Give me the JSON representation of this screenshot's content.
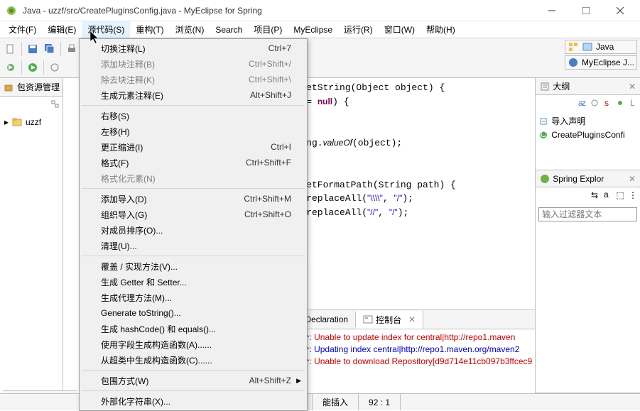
{
  "title": "Java - uzzf/src/CreatePluginsConfig.java - MyEclipse for Spring",
  "menubar": [
    "文件(F)",
    "编辑(E)",
    "源代码(S)",
    "重构(T)",
    "浏览(N)",
    "Search",
    "项目(P)",
    "MyEclipse",
    "运行(R)",
    "窗口(W)",
    "帮助(H)"
  ],
  "active_menu_index": 2,
  "source_menu": {
    "items": [
      {
        "label": "切换注释(L)",
        "shortcut": "Ctrl+7",
        "enabled": true
      },
      {
        "label": "添加块注释(B)",
        "shortcut": "Ctrl+Shift+/",
        "enabled": false
      },
      {
        "label": "除去块注释(K)",
        "shortcut": "Ctrl+Shift+\\",
        "enabled": false
      },
      {
        "label": "生成元素注释(E)",
        "shortcut": "Alt+Shift+J",
        "enabled": true
      },
      {
        "sep": true
      },
      {
        "label": "右移(S)",
        "enabled": true
      },
      {
        "label": "左移(H)",
        "enabled": true
      },
      {
        "label": "更正缩进(I)",
        "shortcut": "Ctrl+I",
        "enabled": true
      },
      {
        "label": "格式(F)",
        "shortcut": "Ctrl+Shift+F",
        "enabled": true
      },
      {
        "label": "格式化元素(N)",
        "enabled": false
      },
      {
        "sep": true
      },
      {
        "label": "添加导入(D)",
        "shortcut": "Ctrl+Shift+M",
        "enabled": true
      },
      {
        "label": "组织导入(G)",
        "shortcut": "Ctrl+Shift+O",
        "enabled": true
      },
      {
        "label": "对成员排序(O)...",
        "enabled": true
      },
      {
        "label": "清理(U)...",
        "enabled": true
      },
      {
        "sep": true
      },
      {
        "label": "覆盖 / 实现方法(V)...",
        "enabled": true
      },
      {
        "label": "生成 Getter 和 Setter...",
        "enabled": true
      },
      {
        "label": "生成代理方法(M)...",
        "enabled": true
      },
      {
        "label": "Generate toString()...",
        "enabled": true
      },
      {
        "label": "生成 hashCode() 和 equals()...",
        "enabled": true
      },
      {
        "label": "使用字段生成构造函数(A)......",
        "enabled": true
      },
      {
        "label": "从超类中生成构造函数(C)......",
        "enabled": true
      },
      {
        "sep": true
      },
      {
        "label": "包围方式(W)",
        "shortcut": "Alt+Shift+Z",
        "submenu": true,
        "enabled": true
      },
      {
        "sep": true
      },
      {
        "label": "外部化字符串(X)...",
        "enabled": true
      }
    ]
  },
  "perspective": {
    "java": "Java",
    "myeclipse": "MyEclipse J..."
  },
  "left_panel": {
    "title": "包资源管理",
    "project": "uzzf"
  },
  "editor": {
    "l1a": "getString(Object object) {",
    "l2a": "== ",
    "l2b": "null",
    "l2c": ") {",
    "l3a": "\"",
    "l3b": ";",
    "l5a": "ing.",
    "l5b": "valueOf",
    "l5c": "(object);",
    "l7a": "getFormatPath(String path) {",
    "l8a": ".replaceAll(",
    "l8b": "\"\\\\\\\\\"",
    "l8c": ", ",
    "l8d": "\"/\"",
    "l8e": ");",
    "l9a": ".replaceAll(",
    "l9b": "\"//\"",
    "l9c": ", ",
    "l9d": "\"/\"",
    "l9e": ");"
  },
  "bottom_tabs": {
    "declaration": "Declaration",
    "console": "控制台"
  },
  "console_lines": [
    {
      "prefix": "少",
      "cls": "red",
      "text": ": Unable to update index for central|http://repo1.maven"
    },
    {
      "prefix": "少",
      "cls": "blue",
      "text": ": Updating index central|http://repo1.maven.org/maven2"
    },
    {
      "prefix": "少",
      "cls": "red",
      "text": ": Unable to download Repository[d9d714e11cb097b3ffcec9"
    }
  ],
  "outline": {
    "title": "大纲",
    "items": [
      {
        "icon": "import",
        "label": "导入声明"
      },
      {
        "icon": "class",
        "label": "CreatePluginsConfi"
      }
    ]
  },
  "spring": {
    "title": "Spring Explor",
    "filter_placeholder": "输入过滤器文本"
  },
  "statusbar": {
    "insert": "能插入",
    "cursor": "92 : 1"
  }
}
